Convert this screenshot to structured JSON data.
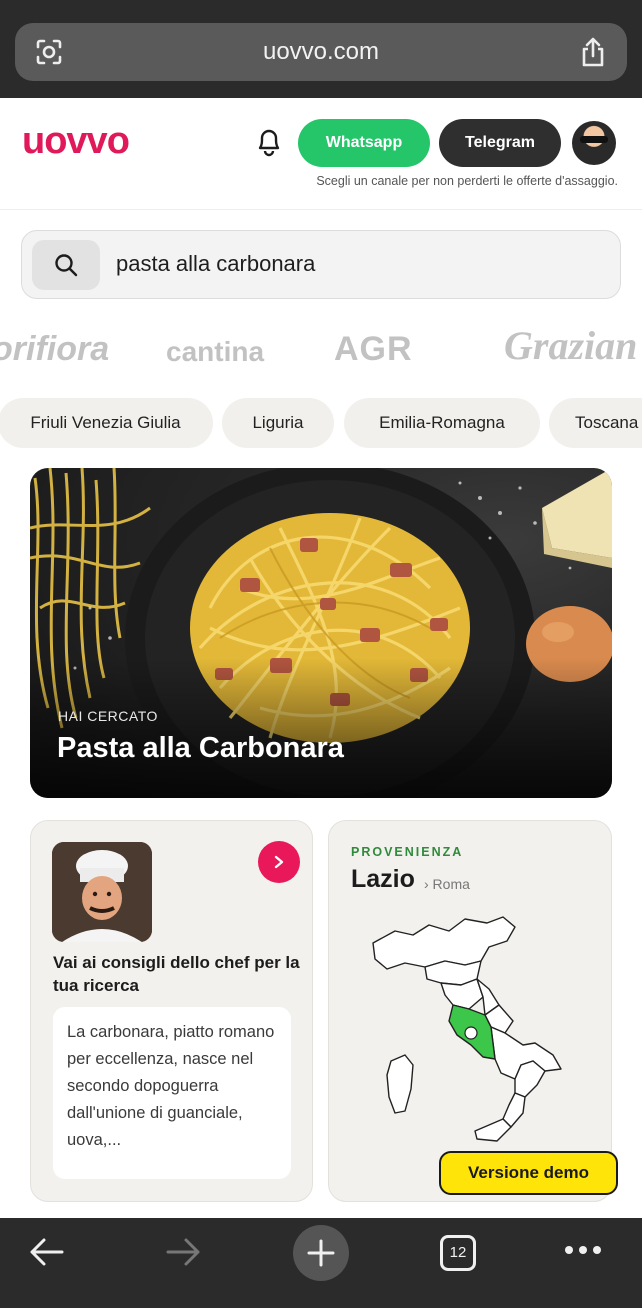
{
  "browser": {
    "url": "uovvo.com",
    "tab_count": "12"
  },
  "header": {
    "logo": "uovvo",
    "whatsapp_label": "Whatsapp",
    "telegram_label": "Telegram",
    "subtitle": "Scegli un canale per non perderti le offerte d'assaggio."
  },
  "search": {
    "value": "pasta alla carbonara"
  },
  "brands": [
    "orifiora",
    "cantina",
    "AGR",
    "Grazian"
  ],
  "regions": [
    "Friuli Venezia Giulia",
    "Liguria",
    "Emilia-Romagna",
    "Toscana"
  ],
  "hero": {
    "kicker": "HAI CERCATO",
    "title": "Pasta alla Carbonara"
  },
  "chef_card": {
    "title": "Vai ai consigli dello chef per la tua ricerca",
    "text": "La carbonara, piatto romano per eccellenza, nasce nel secondo dopoguerra dall'unione di guanciale, uova,..."
  },
  "origin_card": {
    "kicker": "PROVENIENZA",
    "region": "Lazio",
    "city": "› Roma",
    "highlight_color": "#3cc64a"
  },
  "demo_badge": "Versione demo",
  "colors": {
    "brand": "#e0195a",
    "whatsapp": "#25c66a",
    "telegram": "#2f2f2f",
    "demo": "#ffe40a"
  }
}
